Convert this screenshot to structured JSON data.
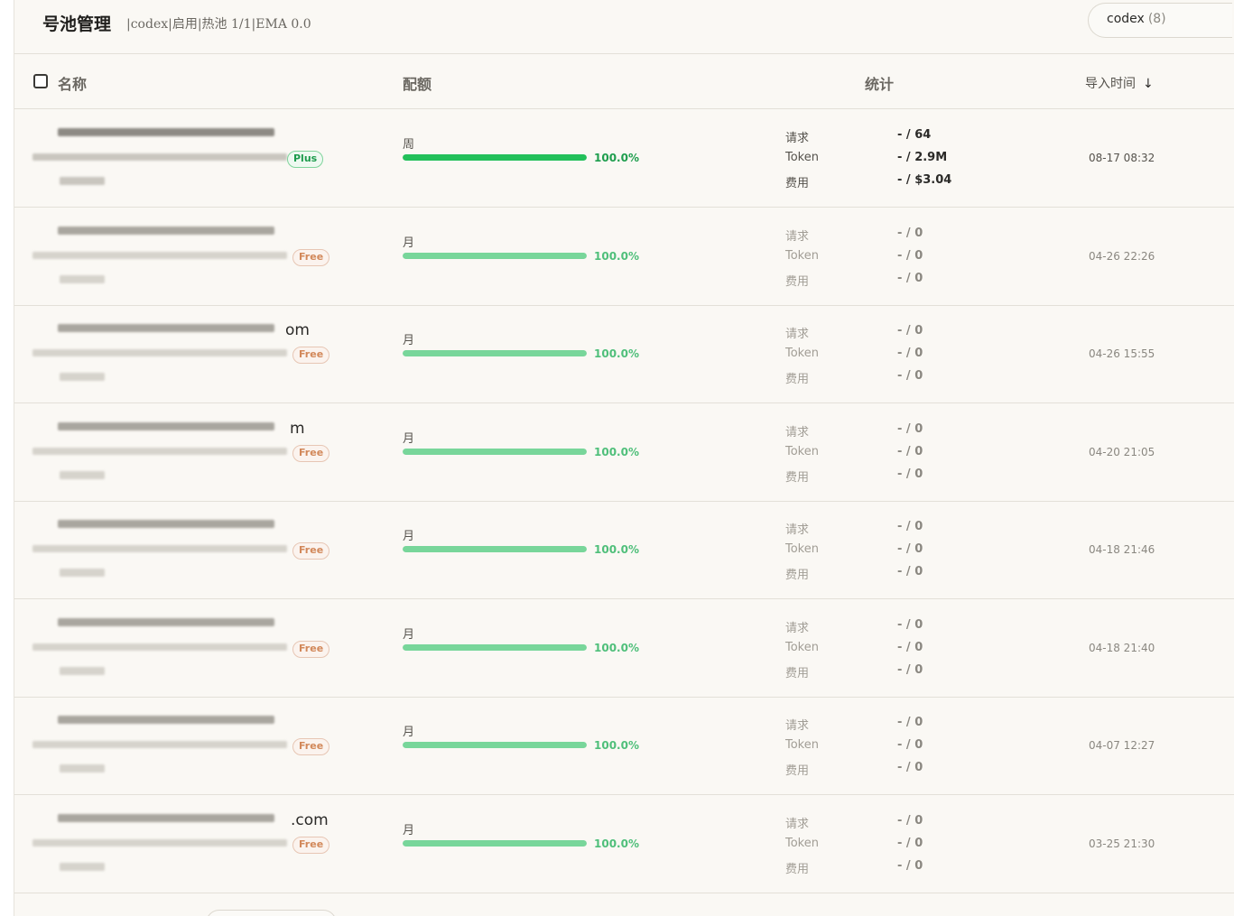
{
  "header": {
    "title": "号池管理",
    "subtitle": "|codex|启用|热池 1/1|EMA 0.0",
    "provider_select": {
      "value": "codex",
      "count": "(8)"
    }
  },
  "table": {
    "columns": {
      "name": "名称",
      "quota": "配额",
      "stats": "统计",
      "import_time": "导入时间"
    },
    "stat_labels": {
      "requests": "请求",
      "token": "Token",
      "cost": "费用"
    },
    "rows": [
      {
        "name_suffix": "",
        "plan": "Plus",
        "period": "周",
        "quota_pct": 100.0,
        "quota_label": "100.0%",
        "requests": "- / 64",
        "token": "- / 2.9M",
        "cost": "- / $3.04",
        "time": "08-17 08:32",
        "active": true
      },
      {
        "name_suffix": "",
        "plan": "Free",
        "period": "月",
        "quota_pct": 100.0,
        "quota_label": "100.0%",
        "requests": "- / 0",
        "token": "- / 0",
        "cost": "- / 0",
        "time": "04-26 22:26",
        "active": false
      },
      {
        "name_suffix": "om",
        "plan": "Free",
        "period": "月",
        "quota_pct": 100.0,
        "quota_label": "100.0%",
        "requests": "- / 0",
        "token": "- / 0",
        "cost": "- / 0",
        "time": "04-26 15:55",
        "active": false
      },
      {
        "name_suffix": "m",
        "plan": "Free",
        "period": "月",
        "quota_pct": 100.0,
        "quota_label": "100.0%",
        "requests": "- / 0",
        "token": "- / 0",
        "cost": "- / 0",
        "time": "04-20 21:05",
        "active": false
      },
      {
        "name_suffix": "",
        "plan": "Free",
        "period": "月",
        "quota_pct": 100.0,
        "quota_label": "100.0%",
        "requests": "- / 0",
        "token": "- / 0",
        "cost": "- / 0",
        "time": "04-18 21:46",
        "active": false
      },
      {
        "name_suffix": "",
        "plan": "Free",
        "period": "月",
        "quota_pct": 100.0,
        "quota_label": "100.0%",
        "requests": "- / 0",
        "token": "- / 0",
        "cost": "- / 0",
        "time": "04-18 21:40",
        "active": false
      },
      {
        "name_suffix": "",
        "plan": "Free",
        "period": "月",
        "quota_pct": 100.0,
        "quota_label": "100.0%",
        "requests": "- / 0",
        "token": "- / 0",
        "cost": "- / 0",
        "time": "04-07 12:27",
        "active": false
      },
      {
        "name_suffix": ".com",
        "plan": "Free",
        "period": "月",
        "quota_pct": 100.0,
        "quota_label": "100.0%",
        "requests": "- / 0",
        "token": "- / 0",
        "cost": "- / 0",
        "time": "03-25 21:30",
        "active": false
      }
    ]
  },
  "colors": {
    "bar_active": "#22c05a",
    "bar_idle": "#78d69a",
    "pct_active": "#1f9e4e",
    "pct_idle": "#4fbf7a"
  }
}
